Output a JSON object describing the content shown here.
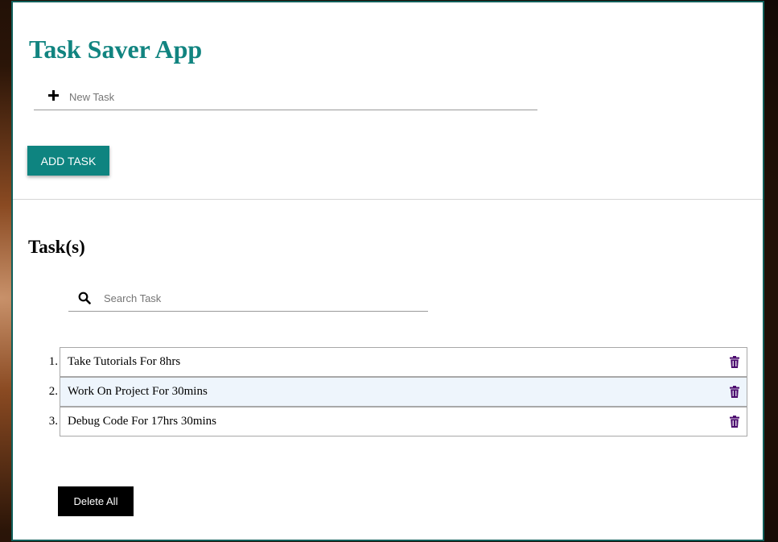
{
  "app": {
    "title": "Task Saver App"
  },
  "new_task": {
    "placeholder": "New Task",
    "value": "",
    "icon": "plus-icon"
  },
  "add_button": {
    "label": "ADD TASK",
    "color": "#0e8480"
  },
  "tasks_section": {
    "heading": "Task(s)"
  },
  "search": {
    "placeholder": "Search Task",
    "value": "",
    "icon": "search-icon"
  },
  "tasks": [
    {
      "number": "1.",
      "text": "Take Tutorials For 8hrs",
      "highlighted": false
    },
    {
      "number": "2.",
      "text": "Work On Project For 30mins",
      "highlighted": true
    },
    {
      "number": "3.",
      "text": "Debug Code For 17hrs 30mins",
      "highlighted": false
    }
  ],
  "delete_icon": {
    "icon": "trash-icon",
    "color": "#4b0a6e"
  },
  "delete_all_button": {
    "label": "Delete All"
  },
  "colors": {
    "accent": "#118480",
    "frame_border": "#0f5e5a",
    "highlight_row": "#eef5fc"
  }
}
